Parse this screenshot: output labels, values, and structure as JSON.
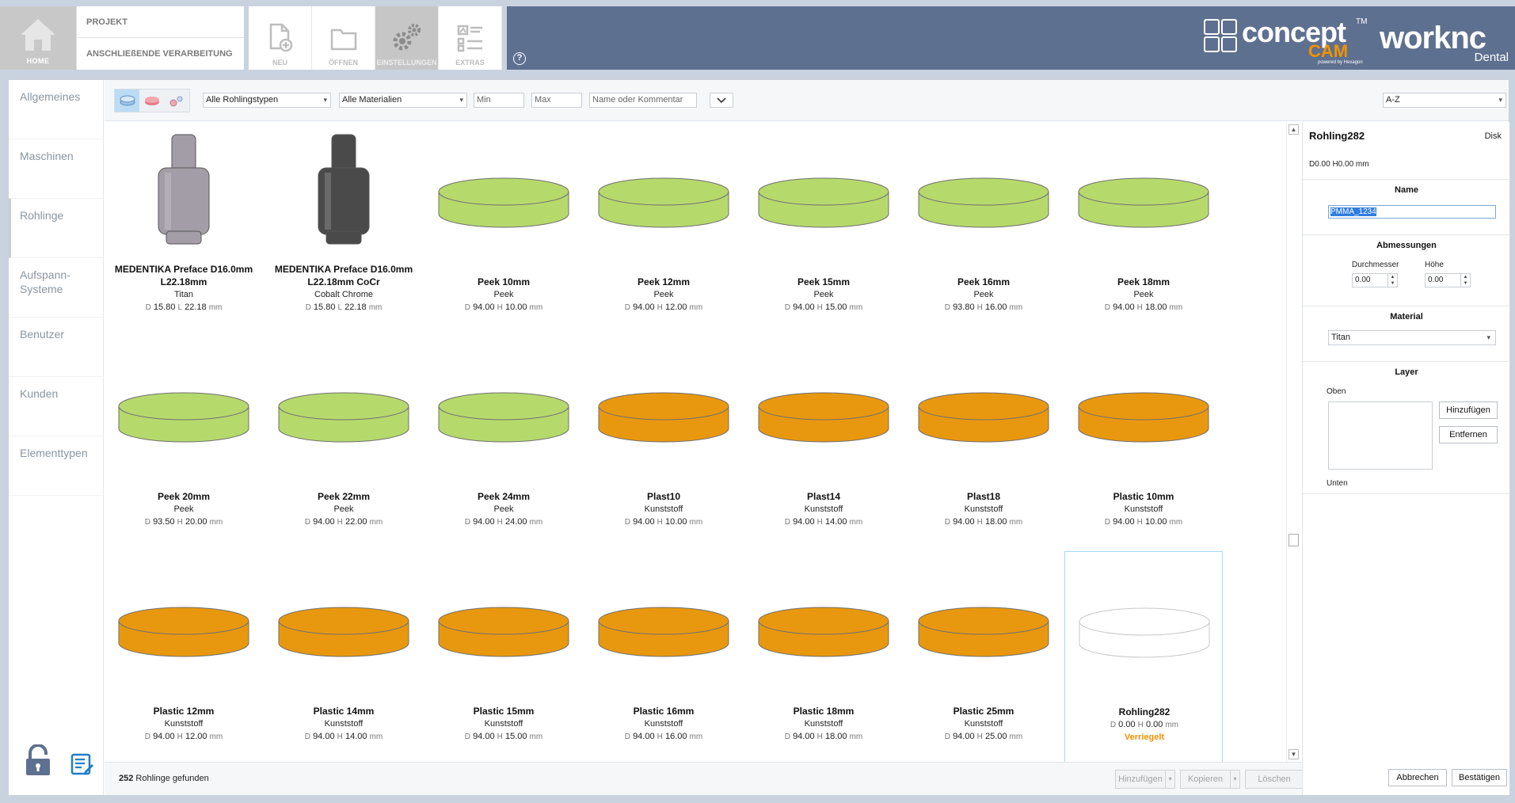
{
  "topbar": {
    "home_label": "HOME",
    "project_label": "PROJEKT",
    "followup_label": "ANSCHLIEßENDE VERARBEITUNG",
    "tools": [
      {
        "label": "NEU",
        "icon": "new-file-icon"
      },
      {
        "label": "ÖFFNEN",
        "icon": "open-folder-icon"
      },
      {
        "label": "EINSTELLUNGEN",
        "icon": "gear-icon"
      },
      {
        "label": "EXTRAS",
        "icon": "extras-icon"
      }
    ],
    "help": "?",
    "brand": {
      "concept": "concept",
      "tm": "TM",
      "cam": "CAM",
      "powered": "powered by Hexagon",
      "worknc": "worknc",
      "dental": "Dental"
    }
  },
  "sidebar": {
    "items": [
      {
        "label": "Allgemeines"
      },
      {
        "label": "Maschinen"
      },
      {
        "label": "Rohlinge"
      },
      {
        "label": "Aufspann-Systeme"
      },
      {
        "label": "Benutzer"
      },
      {
        "label": "Kunden"
      },
      {
        "label": "Elementtypen"
      }
    ]
  },
  "filter": {
    "type_value": "Alle Rohlingstypen",
    "material_value": "Alle Materialien",
    "min_placeholder": "Min",
    "max_placeholder": "Max",
    "search_placeholder": "Name oder Kommentar",
    "sort_value": "A-Z"
  },
  "colors": {
    "green": "#b6d96c",
    "orange": "#e8980f",
    "titan": "#a39da7",
    "cocr": "#4a4a4a",
    "accent": "#f39200"
  },
  "blanks": [
    {
      "name": "MEDENTIKA  Preface D16.0mm L22.18mm",
      "material": "Titan",
      "dk": "D",
      "d": "15.80",
      "hk": "L",
      "h": "22.18",
      "shape": "abutment",
      "color": "#a39da7"
    },
    {
      "name": "MEDENTIKA  Preface D16.0mm L22.18mm CoCr",
      "material": "Cobalt Chrome",
      "dk": "D",
      "d": "15.80",
      "hk": "L",
      "h": "22.18",
      "shape": "abutment",
      "color": "#4a4a4a"
    },
    {
      "name": "Peek 10mm",
      "material": "Peek",
      "dk": "D",
      "d": "94.00",
      "hk": "H",
      "h": "10.00",
      "shape": "disk",
      "color": "#b6d96c"
    },
    {
      "name": "Peek 12mm",
      "material": "Peek",
      "dk": "D",
      "d": "94.00",
      "hk": "H",
      "h": "12.00",
      "shape": "disk",
      "color": "#b6d96c"
    },
    {
      "name": "Peek 15mm",
      "material": "Peek",
      "dk": "D",
      "d": "94.00",
      "hk": "H",
      "h": "15.00",
      "shape": "disk",
      "color": "#b6d96c"
    },
    {
      "name": "Peek 16mm",
      "material": "Peek",
      "dk": "D",
      "d": "93.80",
      "hk": "H",
      "h": "16.00",
      "shape": "disk",
      "color": "#b6d96c"
    },
    {
      "name": "Peek 18mm",
      "material": "Peek",
      "dk": "D",
      "d": "94.00",
      "hk": "H",
      "h": "18.00",
      "shape": "disk",
      "color": "#b6d96c"
    },
    {
      "name": "Peek 20mm",
      "material": "Peek",
      "dk": "D",
      "d": "93.50",
      "hk": "H",
      "h": "20.00",
      "shape": "disk",
      "color": "#b6d96c"
    },
    {
      "name": "Peek 22mm",
      "material": "Peek",
      "dk": "D",
      "d": "94.00",
      "hk": "H",
      "h": "22.00",
      "shape": "disk",
      "color": "#b6d96c"
    },
    {
      "name": "Peek 24mm",
      "material": "Peek",
      "dk": "D",
      "d": "94.00",
      "hk": "H",
      "h": "24.00",
      "shape": "disk",
      "color": "#b6d96c"
    },
    {
      "name": "Plast10",
      "material": "Kunststoff",
      "dk": "D",
      "d": "94.00",
      "hk": "H",
      "h": "10.00",
      "shape": "disk",
      "color": "#e8980f"
    },
    {
      "name": "Plast14",
      "material": "Kunststoff",
      "dk": "D",
      "d": "94.00",
      "hk": "H",
      "h": "14.00",
      "shape": "disk",
      "color": "#e8980f"
    },
    {
      "name": "Plast18",
      "material": "Kunststoff",
      "dk": "D",
      "d": "94.00",
      "hk": "H",
      "h": "18.00",
      "shape": "disk",
      "color": "#e8980f"
    },
    {
      "name": "Plastic 10mm",
      "material": "Kunststoff",
      "dk": "D",
      "d": "94.00",
      "hk": "H",
      "h": "10.00",
      "shape": "disk",
      "color": "#e8980f"
    },
    {
      "name": "Plastic 12mm",
      "material": "Kunststoff",
      "dk": "D",
      "d": "94.00",
      "hk": "H",
      "h": "12.00",
      "shape": "disk",
      "color": "#e8980f"
    },
    {
      "name": "Plastic 14mm",
      "material": "Kunststoff",
      "dk": "D",
      "d": "94.00",
      "hk": "H",
      "h": "14.00",
      "shape": "disk",
      "color": "#e8980f"
    },
    {
      "name": "Plastic 15mm",
      "material": "Kunststoff",
      "dk": "D",
      "d": "94.00",
      "hk": "H",
      "h": "15.00",
      "shape": "disk",
      "color": "#e8980f"
    },
    {
      "name": "Plastic 16mm",
      "material": "Kunststoff",
      "dk": "D",
      "d": "94.00",
      "hk": "H",
      "h": "16.00",
      "shape": "disk",
      "color": "#e8980f"
    },
    {
      "name": "Plastic 18mm",
      "material": "Kunststoff",
      "dk": "D",
      "d": "94.00",
      "hk": "H",
      "h": "18.00",
      "shape": "disk",
      "color": "#e8980f"
    },
    {
      "name": "Plastic 25mm",
      "material": "Kunststoff",
      "dk": "D",
      "d": "94.00",
      "hk": "H",
      "h": "25.00",
      "shape": "disk",
      "color": "#e8980f"
    },
    {
      "name": "Rohling282",
      "material": "",
      "dk": "D",
      "d": "0.00",
      "hk": "H",
      "h": "0.00",
      "shape": "disk",
      "color": "#ffffff",
      "locked": "Verriegelt",
      "selected": true
    }
  ],
  "unit": "mm",
  "bottom": {
    "count": "252",
    "found_text": "Rohlinge gefunden",
    "add": "Hinzufügen",
    "copy": "Kopieren",
    "delete": "Löschen"
  },
  "detail": {
    "title": "Rohling282",
    "type": "Disk",
    "dims": "D0.00 H0.00 mm",
    "name_head": "Name",
    "name_value": "PMMA_1234",
    "dims_head": "Abmessungen",
    "diameter_label": "Durchmesser",
    "diameter_value": "0.00",
    "height_label": "Höhe",
    "height_value": "0.00",
    "material_head": "Material",
    "material_value": "Titan",
    "layer_head": "Layer",
    "top_label": "Oben",
    "bottom_label": "Unten",
    "add_btn": "Hinzufügen",
    "remove_btn": "Entfernen",
    "cancel_btn": "Abbrechen",
    "confirm_btn": "Bestätigen"
  }
}
